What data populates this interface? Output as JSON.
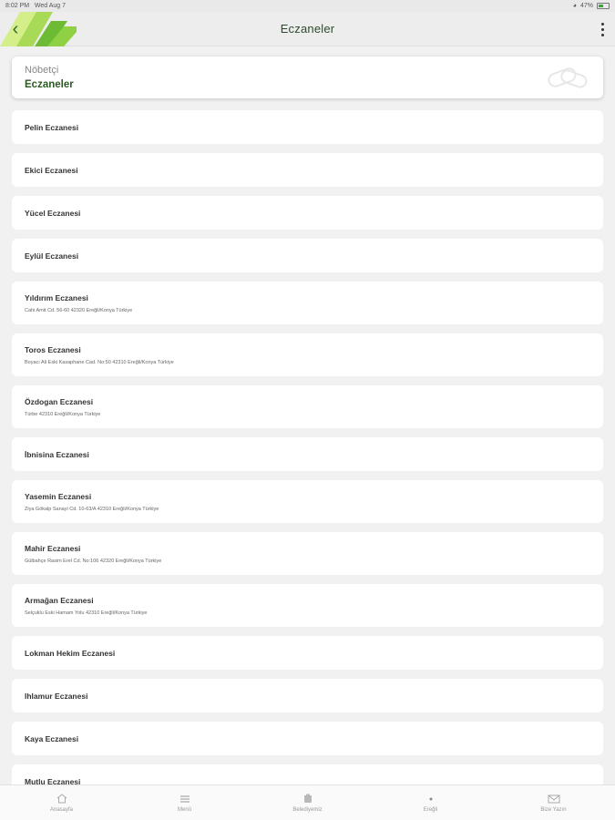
{
  "status_bar": {
    "time": "8:02 PM",
    "date": "Wed Aug 7",
    "battery": "47%"
  },
  "header": {
    "title": "Eczaneler",
    "back_icon": "chevron-left-icon",
    "menu_icon": "more-vertical-icon"
  },
  "hero": {
    "subtitle": "Nöbetçi",
    "title": "Eczaneler"
  },
  "pharmacies": [
    {
      "name": "Pelin Eczanesi",
      "address": ""
    },
    {
      "name": "Ekici Eczanesi",
      "address": ""
    },
    {
      "name": "Yücel Eczanesi",
      "address": ""
    },
    {
      "name": "Eylül Eczanesi",
      "address": ""
    },
    {
      "name": "Yıldırım Eczanesi",
      "address": "Cahi Amit Cd. 56-60 42320 Ereğli/Konya Türkiye"
    },
    {
      "name": "Toros Eczanesi",
      "address": "Boyacı Ali Eski Kasaphane Cad. No:50 42310 Ereğli/Konya Türkiye"
    },
    {
      "name": "Özdogan Eczanesi",
      "address": "Türbe 42310 Ereğli/Konya Türkiye"
    },
    {
      "name": "İbnisina Eczanesi",
      "address": ""
    },
    {
      "name": "Yasemin Eczanesi",
      "address": "Ziya Gökalp Sanayi Cd. 10-63/A 42310 Ereğli/Konya Türkiye"
    },
    {
      "name": "Mahir Eczanesi",
      "address": "Gülbahçe Rasim Erel Cd. No:106 42320 Ereğli/Konya Türkiye"
    },
    {
      "name": "Armağan Eczanesi",
      "address": "Selçuklu Eski Hamam Yolu 42310 Ereğli/Konya Türkiye"
    },
    {
      "name": "Lokman Hekim Eczanesi",
      "address": ""
    },
    {
      "name": "Ihlamur Eczanesi",
      "address": ""
    },
    {
      "name": "Kaya Eczanesi",
      "address": ""
    },
    {
      "name": "Mutlu Eczanesi",
      "address": ""
    }
  ],
  "tabs": [
    {
      "label": "Anasayfa",
      "icon": "home-icon"
    },
    {
      "label": "Menü",
      "icon": "menu-icon"
    },
    {
      "label": "Belediyemiz",
      "icon": "building-icon"
    },
    {
      "label": "Ereğli",
      "icon": "location-icon"
    },
    {
      "label": "Bize Yazın",
      "icon": "mail-icon"
    }
  ],
  "colors": {
    "brand_green": "#2c5a22",
    "logo_light": "#b6e06a",
    "logo_dark": "#5fae2e"
  }
}
